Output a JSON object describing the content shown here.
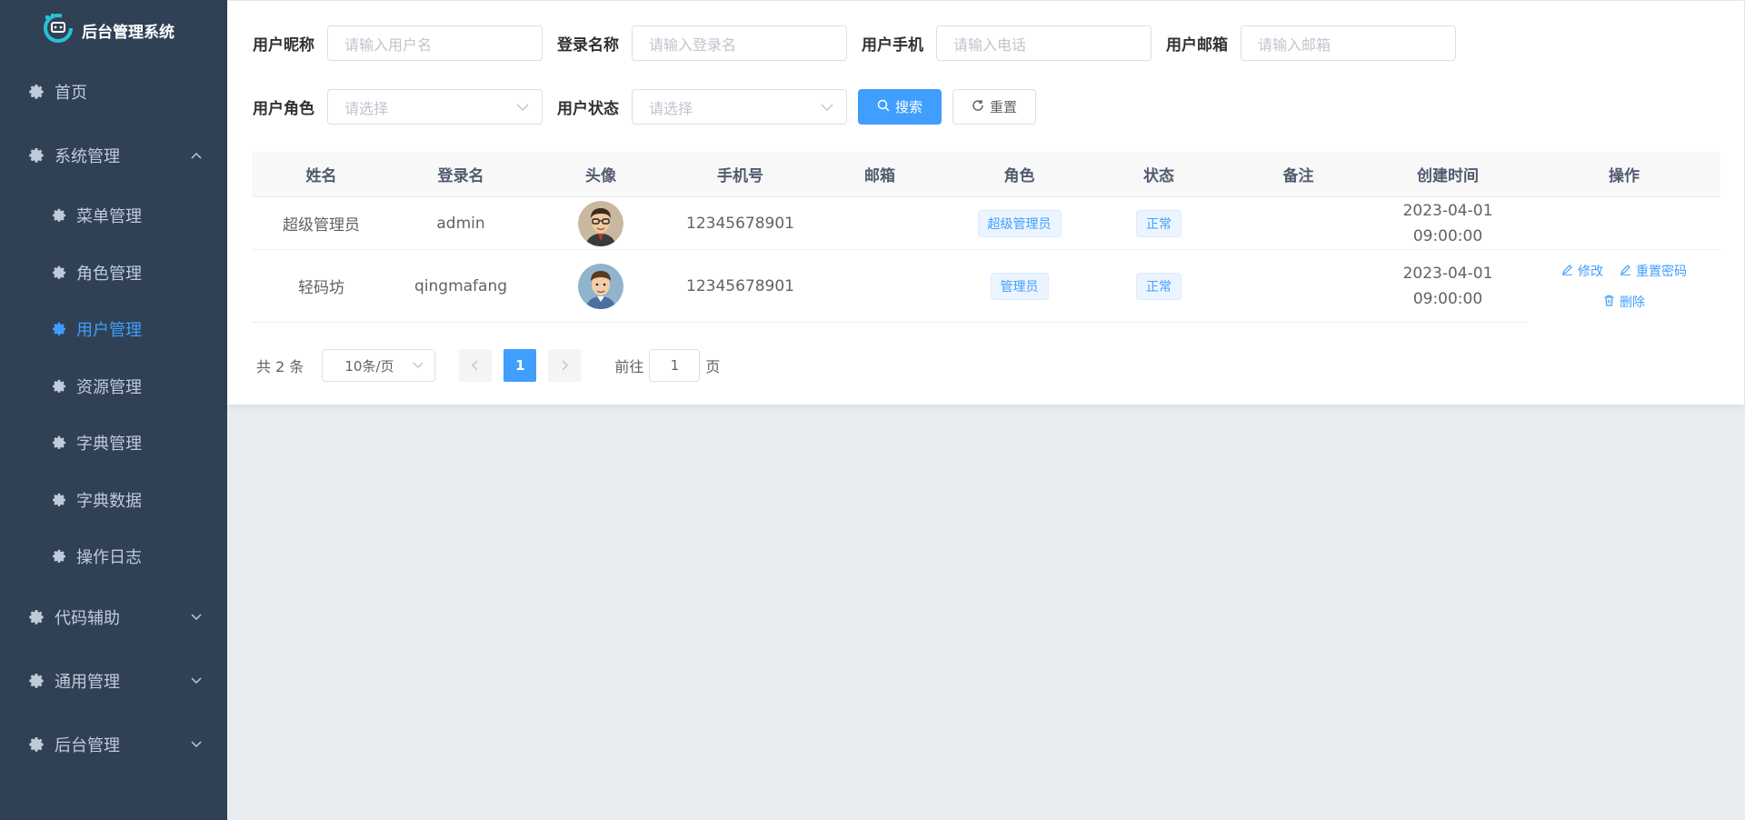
{
  "brand": {
    "title": "后台管理系统"
  },
  "sidebar": {
    "items": [
      {
        "label": "首页"
      },
      {
        "label": "系统管理"
      },
      {
        "label": "代码辅助"
      },
      {
        "label": "通用管理"
      },
      {
        "label": "后台管理"
      }
    ],
    "sub_items": [
      {
        "label": "菜单管理"
      },
      {
        "label": "角色管理"
      },
      {
        "label": "用户管理"
      },
      {
        "label": "资源管理"
      },
      {
        "label": "字典管理"
      },
      {
        "label": "字典数据"
      },
      {
        "label": "操作日志"
      }
    ],
    "active_color": "#409eff"
  },
  "search": {
    "nickname_label": "用户昵称",
    "nickname_placeholder": "请输入用户名",
    "login_label": "登录名称",
    "login_placeholder": "请输入登录名",
    "phone_label": "用户手机",
    "phone_placeholder": "请输入电话",
    "email_label": "用户邮箱",
    "email_placeholder": "请输入邮箱",
    "role_label": "用户角色",
    "role_placeholder": "请选择",
    "status_label": "用户状态",
    "status_placeholder": "请选择",
    "search_button": "搜索",
    "reset_button": "重置"
  },
  "table": {
    "columns": [
      "姓名",
      "登录名",
      "头像",
      "手机号",
      "邮箱",
      "角色",
      "状态",
      "备注",
      "创建时间",
      "操作"
    ],
    "rows": [
      {
        "name": "超级管理员",
        "login": "admin",
        "phone": "12345678901",
        "email": "",
        "role": "超级管理员",
        "status": "正常",
        "remark": "",
        "created": "2023-04-01 09:00:00"
      },
      {
        "name": "轻码坊",
        "login": "qingmafang",
        "phone": "12345678901",
        "email": "",
        "role": "管理员",
        "status": "正常",
        "remark": "",
        "created": "2023-04-01 09:00:00"
      }
    ],
    "ops": {
      "edit": "修改",
      "reset_pwd": "重置密码",
      "delete": "删除"
    }
  },
  "pager": {
    "total": "共 2 条",
    "page_size": "10条/页",
    "current_page": "1",
    "goto_prefix": "前往",
    "goto_value": "1",
    "goto_suffix": "页"
  }
}
